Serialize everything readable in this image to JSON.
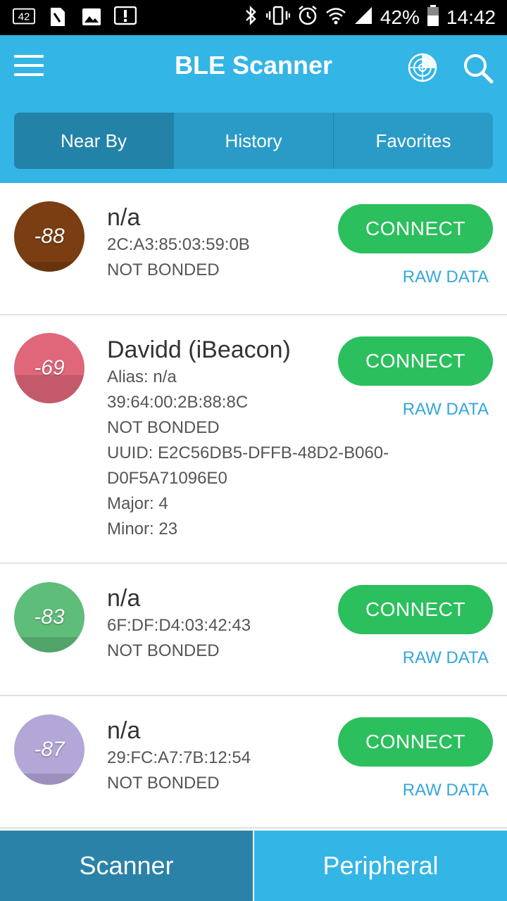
{
  "status_bar": {
    "notification_badge": "42",
    "battery_percent": "42%",
    "time": "14:42"
  },
  "app_bar": {
    "title": "BLE Scanner",
    "icons": [
      "menu-icon",
      "radar-icon",
      "search-icon"
    ]
  },
  "tabs": [
    {
      "label": "Near By",
      "active": true
    },
    {
      "label": "History",
      "active": false
    },
    {
      "label": "Favorites",
      "active": false
    }
  ],
  "devices": [
    {
      "rssi": "-88",
      "color": "#7a3e12",
      "name": "n/a",
      "lines": [
        "2C:A3:85:03:59:0B",
        "NOT BONDED"
      ],
      "connect_label": "CONNECT",
      "raw_label": "RAW DATA"
    },
    {
      "rssi": "-69",
      "color": "#e0667a",
      "name": "Davidd (iBeacon)",
      "lines": [
        "Alias: n/a",
        "39:64:00:2B:88:8C",
        "NOT BONDED",
        "UUID: E2C56DB5-DFFB-48D2-B060-",
        "D0F5A71096E0",
        "Major: 4",
        "Minor: 23"
      ],
      "connect_label": "CONNECT",
      "raw_label": "RAW DATA"
    },
    {
      "rssi": "-83",
      "color": "#5fbd7a",
      "name": "n/a",
      "lines": [
        "6F:DF:D4:03:42:43",
        "NOT BONDED"
      ],
      "connect_label": "CONNECT",
      "raw_label": "RAW DATA"
    },
    {
      "rssi": "-87",
      "color": "#b3a7d8",
      "name": "n/a",
      "lines": [
        "29:FC:A7:7B:12:54",
        "NOT BONDED"
      ],
      "connect_label": "CONNECT",
      "raw_label": "RAW DATA"
    }
  ],
  "bottom_bar": {
    "scanner_label": "Scanner",
    "peripheral_label": "Peripheral"
  },
  "colors": {
    "primary": "#33b5e5",
    "connect_green": "#2bbf5d",
    "raw_data_blue": "#33a7dc"
  }
}
